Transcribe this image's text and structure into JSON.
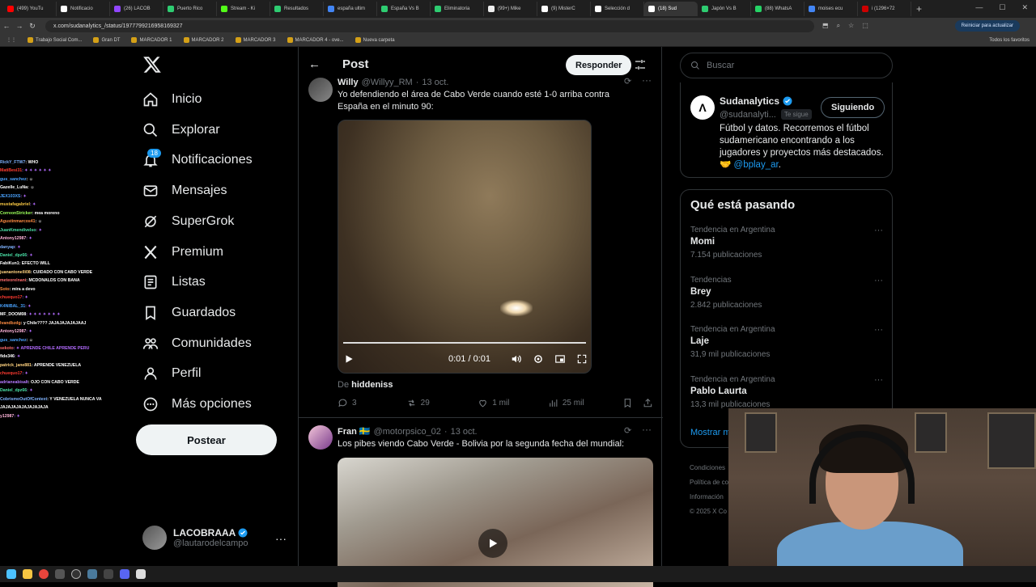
{
  "browser": {
    "tabs": [
      {
        "label": "(499) YouTu",
        "color": "#ff0000"
      },
      {
        "label": "Notificacio",
        "color": "#ffffff"
      },
      {
        "label": "(26) LACOB",
        "color": "#9146ff"
      },
      {
        "label": "Puerto Rico",
        "color": "#2ecc71"
      },
      {
        "label": "Stream - Ki",
        "color": "#53fc18"
      },
      {
        "label": "Resultados",
        "color": "#2ecc71"
      },
      {
        "label": "españa ultim",
        "color": "#4285f4"
      },
      {
        "label": "España Vs B",
        "color": "#2ecc71"
      },
      {
        "label": "Eliminatoria",
        "color": "#2ecc71"
      },
      {
        "label": "(99+) Mike",
        "color": "#eeeeee"
      },
      {
        "label": "(9) MisterC",
        "color": "#ffffff"
      },
      {
        "label": "Selección d",
        "color": "#ffffff"
      },
      {
        "label": "(18) Sud",
        "color": "#ffffff",
        "active": true
      },
      {
        "label": "Japón Vs B",
        "color": "#2ecc71"
      },
      {
        "label": "(88) WhatsA",
        "color": "#25d366"
      },
      {
        "label": "moises ecu",
        "color": "#4285f4"
      },
      {
        "label": "i (1296×72",
        "color": "#cc0000"
      }
    ],
    "url": "x.com/sudanalytics_/status/1977799216958169327",
    "update_label": "Reiniciar para actualizar",
    "bookmarks": [
      "Trabajo Social Com...",
      "Gran DT",
      "MARCADOR 1",
      "MARCADOR 2",
      "MARCADOR 3",
      "MARCADOR 4 - ove...",
      "Nueva carpeta"
    ],
    "bookmarks_right": "Todos los favoritos"
  },
  "chat": [
    {
      "name": "RickY_FTW7",
      "msg": ": WHO",
      "color": "#7fb3ff"
    },
    {
      "name": "MatiBesi31",
      "msg": ": ✦ ✦ ✦ ✦ ✦ ✦",
      "color": "#ff3b30"
    },
    {
      "name": "gus_sanchez",
      "msg": ": ☺",
      "color": "#4aa3ff"
    },
    {
      "name": "Gazelle_LuNa",
      "msg": ": ☺",
      "color": "#ffffff"
    },
    {
      "name": "JEX103XS",
      "msg": ": ✦",
      "color": "#4aa3ff"
    },
    {
      "name": "mustafagabriel",
      "msg": ": ✦",
      "color": "#f5c542"
    },
    {
      "name": "CorreonStricker",
      "msg": ": mea moreno",
      "color": "#9bff5a"
    },
    {
      "name": "Agustinmarcos41",
      "msg": ": ☺",
      "color": "#ff8c42"
    },
    {
      "name": "JuanKmendivelso",
      "msg": ": ✦",
      "color": "#4ae0a6"
    },
    {
      "name": "Antony12987",
      "msg": ": ✦",
      "color": "#ffb3d9"
    },
    {
      "name": "danyap",
      "msg": ": ✦",
      "color": "#7fb3ff"
    },
    {
      "name": "Daniel_dpz66",
      "msg": ": ✦",
      "color": "#4ae0a6"
    },
    {
      "name": "FabiKun1",
      "msg": ": EFECTO WILL",
      "color": "#ffffff"
    },
    {
      "name": "juanantonelli08",
      "msg": ": CUIDADO CON CABO VERDE",
      "color": "#ffd27f"
    },
    {
      "name": "meteorelnani",
      "msg": ": MCDONALDS CON BANA",
      "color": "#ff6b6b"
    },
    {
      "name": "Soto",
      "msg": ": mira a devo",
      "color": "#ff8c42"
    },
    {
      "name": "chuequo17",
      "msg": ": ✦",
      "color": "#ff3b30"
    },
    {
      "name": "K4NIBAL_31",
      "msg": ": ✦",
      "color": "#4aa3ff"
    },
    {
      "name": "MF_DOOM08",
      "msg": ": ✦ ✦ ✦ ✦ ✦ ✦ ✦",
      "color": "#ffffff"
    },
    {
      "name": "Ivandbzdg",
      "msg": ": y Chile???? JAJAJAJAJAJAAJ",
      "color": "#ff8c42"
    },
    {
      "name": "Antony12987",
      "msg": ": ✦",
      "color": "#ffb3d9"
    },
    {
      "name": "gus_sanchez",
      "msg": ": ☺",
      "color": "#4aa3ff"
    },
    {
      "name": "sekoto",
      "msg": ": ✦ APRENDE CHILE APRENDE PERU",
      "color": "#ff6b6b"
    },
    {
      "name": "fide346",
      "msg": ": ✦",
      "color": "#ffffff"
    },
    {
      "name": "patrick_jane881",
      "msg": ": APRENDE VENEZUELA",
      "color": "#ffd27f"
    },
    {
      "name": "chuequo17",
      "msg": ": ✦",
      "color": "#ff3b30"
    },
    {
      "name": "adrianeabisalt",
      "msg": ": OJO CON CABO VERDE",
      "color": "#b57bff"
    },
    {
      "name": "Daniel_dpz66",
      "msg": ": ✦",
      "color": "#4ae0a6"
    },
    {
      "name": "CobrismoOutOfContext",
      "msg": ": Y VENEZUELA NUNCA VA",
      "color": "#7fb3ff"
    },
    {
      "name": "",
      "msg": "JAJAJAJAJAJAJAJAJA",
      "color": "#ffffff"
    },
    {
      "name": "y12987",
      "msg": ": ✦",
      "color": "#ffb3d9"
    }
  ],
  "sidebar": {
    "items": [
      {
        "label": "Inicio",
        "icon": "home-icon"
      },
      {
        "label": "Explorar",
        "icon": "search-icon"
      },
      {
        "label": "Notificaciones",
        "icon": "bell-icon"
      },
      {
        "label": "Mensajes",
        "icon": "mail-icon"
      },
      {
        "label": "SuperGrok",
        "icon": "grok-icon"
      },
      {
        "label": "Premium",
        "icon": "x-premium-icon"
      },
      {
        "label": "Listas",
        "icon": "list-icon"
      },
      {
        "label": "Guardados",
        "icon": "bookmark-icon"
      },
      {
        "label": "Comunidades",
        "icon": "communities-icon"
      },
      {
        "label": "Perfil",
        "icon": "person-icon"
      },
      {
        "label": "Más opciones",
        "icon": "more-circle-icon"
      }
    ],
    "notif_badge": "18",
    "post_label": "Postear",
    "account_name": "LACOBRAAA",
    "account_handle": "@lautarodelcampo"
  },
  "main": {
    "title": "Post",
    "reply_label": "Responder",
    "tweet1": {
      "name": "Willy",
      "handle": "@Willyy_RM",
      "date": "13 oct.",
      "text": "Yo defendiendo el área de Cabo Verde cuando esté 1-0 arriba contra España en el minuto 90:",
      "video_time": "0:01 / 0:01",
      "video_progress": 1.0,
      "from_label": "De",
      "from_user": "hiddeniss",
      "replies": "3",
      "reposts": "29",
      "likes": "1 mil",
      "views": "25 mil"
    },
    "tweet2": {
      "name": "Fran 🇸🇪",
      "handle": "@motorpsico_02",
      "date": "13 oct.",
      "text": "Los pibes viendo Cabo Verde - Bolivia por la segunda fecha del mundial:"
    }
  },
  "right": {
    "search_placeholder": "Buscar",
    "profile_card": {
      "name": "Sudanalytics",
      "handle": "@sudanalyti...",
      "follows_you": "Te sigue",
      "follow_label": "Siguiendo",
      "bio": "Fútbol y datos. Recorremos el fútbol sudamericano encontrando a los jugadores y proyectos más destacados. 🤝",
      "bio_link": "@bplay_ar",
      "bio_end": "."
    },
    "trends_title": "Qué está pasando",
    "trends": [
      {
        "category": "Tendencia en Argentina",
        "name": "Momi",
        "count": "7.154 publicaciones"
      },
      {
        "category": "Tendencias",
        "name": "Brey",
        "count": "2.842 publicaciones"
      },
      {
        "category": "Tendencia en Argentina",
        "name": "Laje",
        "count": "31,9 mil publicaciones"
      },
      {
        "category": "Tendencia en Argentina",
        "name": "Pablo Laurta",
        "count": "13,3 mil publicaciones"
      }
    ],
    "show_more": "Mostrar m",
    "footer": [
      "Condiciones",
      "Política de co",
      "Información",
      "© 2025 X Co"
    ]
  }
}
